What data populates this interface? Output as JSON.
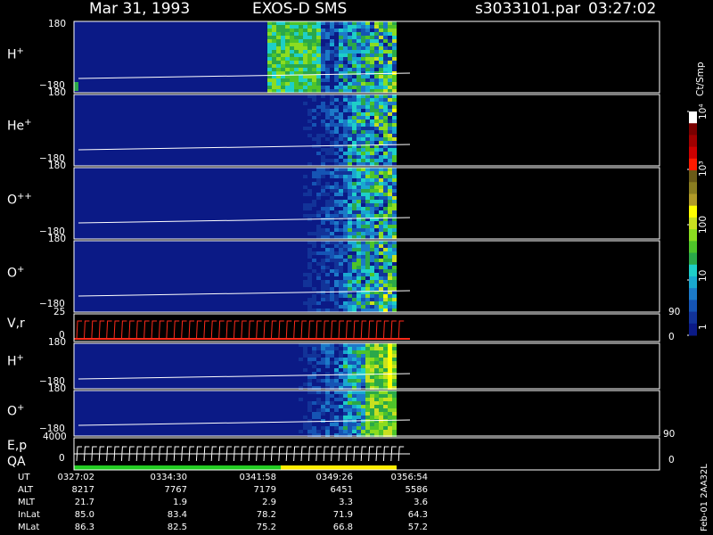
{
  "header": {
    "date": "Mar 31, 1993",
    "instrument": "EXOS-D SMS",
    "file": "s3033101.par",
    "time": "03:27:02"
  },
  "colors": {
    "background": "#000000",
    "frame": "#ffffff",
    "ramp": [
      "#0b1a86",
      "#123398",
      "#1554b4",
      "#1c7ac8",
      "#19a8d0",
      "#1ecfc8",
      "#2aa84a",
      "#4ec42a",
      "#8cdc20",
      "#c8e020",
      "#ffff00",
      "#b09a28",
      "#8a7d20",
      "#6a5a18",
      "#ff1a00",
      "#cc0000",
      "#a00000",
      "#7a0000",
      "#ffffff"
    ],
    "vr_line": "#ff2a1a",
    "qa_green": "#22cc22",
    "qa_yellow": "#ffee00"
  },
  "panels": [
    {
      "label": "H",
      "charge": "+",
      "y_top": "180",
      "y_bottom": "−180"
    },
    {
      "label": "He",
      "charge": "+",
      "y_top": "180",
      "y_bottom": "−180"
    },
    {
      "label": "O",
      "charge": "++",
      "y_top": "180",
      "y_bottom": "−180"
    },
    {
      "label": "O",
      "charge": "+",
      "y_top": "180",
      "y_bottom": "−180"
    },
    {
      "label": "V,r",
      "charge": "",
      "y_top": "25",
      "y_bottom": "0",
      "right_top": "90",
      "right_bottom": "0"
    },
    {
      "label": "H",
      "charge": "+",
      "y_top": "180",
      "y_bottom": "−180"
    },
    {
      "label": "O",
      "charge": "+",
      "y_top": "180",
      "y_bottom": "−180",
      "right_bottom": "90"
    },
    {
      "label": "E,p",
      "label2": "QA",
      "charge": "",
      "y_top": "4000",
      "y_bottom": "0",
      "right_bottom": "0"
    }
  ],
  "colorbar": {
    "unit": "Ct/Smp",
    "labels": [
      "10⁴",
      "10³",
      "100",
      "10",
      "1"
    ]
  },
  "footer": {
    "rows": [
      {
        "label": "UT",
        "values": [
          "0327:02",
          "0334:30",
          "0341:58",
          "0349:26",
          "0356:54"
        ]
      },
      {
        "label": "ALT",
        "values": [
          "8217",
          "7767",
          "7179",
          "6451",
          "5586"
        ]
      },
      {
        "label": "MLT",
        "values": [
          "21.7",
          "1.9",
          "2.9",
          "3.3",
          "3.6"
        ]
      },
      {
        "label": "InLat",
        "values": [
          "85.0",
          "83.4",
          "78.2",
          "71.9",
          "64.3"
        ]
      },
      {
        "label": "MLat",
        "values": [
          "86.3",
          "82.5",
          "75.2",
          "66.8",
          "57.2"
        ]
      }
    ],
    "side_note": "Feb-01 2AA32L"
  },
  "chart_data": {
    "type": "heatmap",
    "x_ticks": [
      "0327:02",
      "0334:30",
      "0341:58",
      "0349:26",
      "0356:54"
    ],
    "panels": [
      {
        "name": "H+",
        "ylim": [
          -180,
          180
        ],
        "active_fraction": 0.46
      },
      {
        "name": "He+",
        "ylim": [
          -180,
          180
        ],
        "active_fraction": 0.46
      },
      {
        "name": "O++",
        "ylim": [
          -180,
          180
        ],
        "active_fraction": 0.46
      },
      {
        "name": "O+",
        "ylim": [
          -180,
          180
        ],
        "active_fraction": 0.46
      },
      {
        "name": "V,r",
        "ylim": [
          0,
          25
        ],
        "right_ylim": [
          0,
          90
        ]
      },
      {
        "name": "H+",
        "ylim": [
          -180,
          180
        ],
        "active_fraction": 0.46
      },
      {
        "name": "O+",
        "ylim": [
          -180,
          180
        ],
        "active_fraction": 0.46
      },
      {
        "name": "E,p / QA",
        "ylim": [
          0,
          4000
        ]
      }
    ],
    "colorbar_scale": "log",
    "colorbar_range": [
      1,
      10000
    ]
  }
}
